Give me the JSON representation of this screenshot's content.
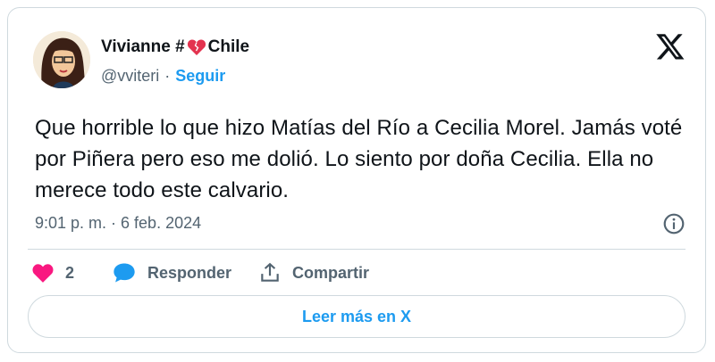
{
  "tweet": {
    "author_name_part1": "Vivianne #",
    "author_name_part2": "Chile",
    "handle": "@vviteri",
    "separator": "·",
    "follow_label": "Seguir",
    "text": "Que horrible lo que hizo Matías del Río a Cecilia Morel. Jamás voté por Piñera pero eso me dolió. Lo siento por doña Cecilia. Ella no merece todo este calvario.",
    "timestamp": "9:01 p. m. · 6 feb. 2024",
    "likes_count": "2",
    "reply_label": "Responder",
    "share_label": "Compartir",
    "read_more_label": "Leer más en X"
  },
  "colors": {
    "accent": "#1d9bf0",
    "like": "#f91880",
    "muted": "#536471",
    "heart_emoji": "#e3334f"
  },
  "icons": [
    "broken-heart-icon",
    "x-logo-icon",
    "info-icon",
    "heart-icon",
    "reply-bubble-icon",
    "share-icon"
  ]
}
